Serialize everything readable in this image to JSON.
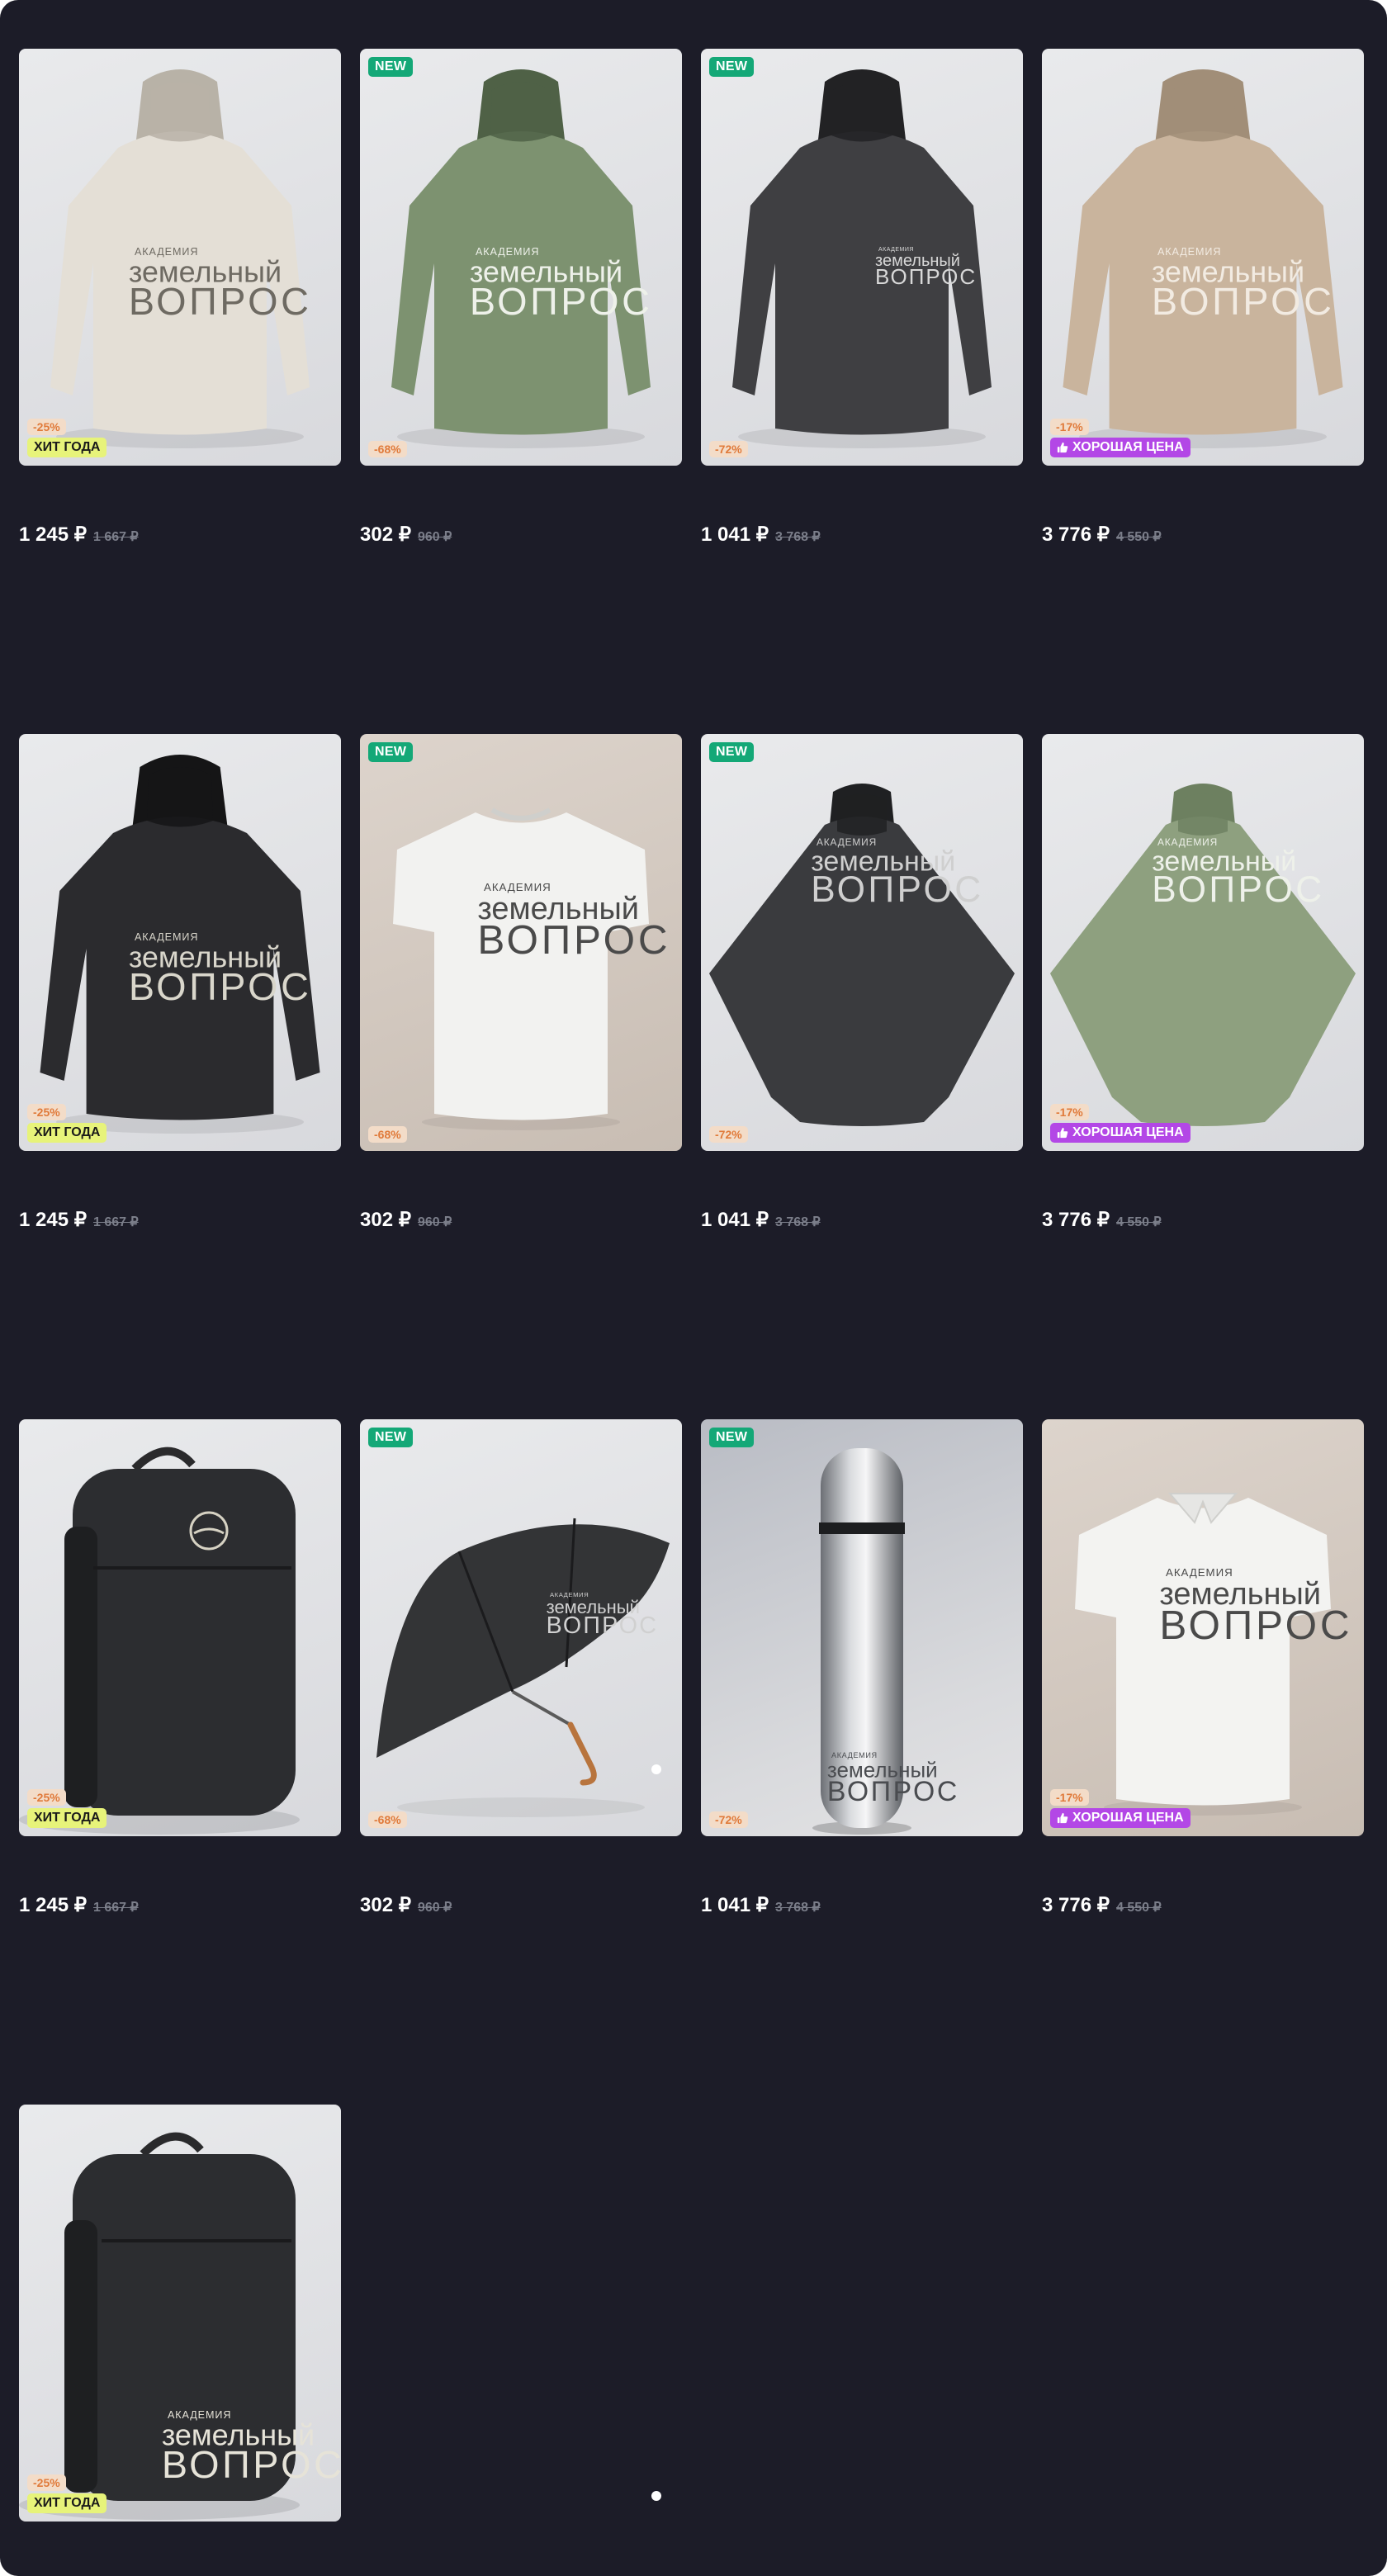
{
  "products": [
    {
      "image": "cream-hoodie",
      "new_badge": "",
      "discount": "-25%",
      "label": "ХИТ ГОДА",
      "label_type": "hit",
      "price": "1 245 ₽",
      "old_price": "1 667 ₽"
    },
    {
      "image": "green-hoodie",
      "new_badge": "NEW",
      "discount": "-68%",
      "label": "",
      "label_type": "",
      "price": "302 ₽",
      "old_price": "960 ₽"
    },
    {
      "image": "graphite-hoodie",
      "new_badge": "NEW",
      "discount": "-72%",
      "label": "",
      "label_type": "",
      "price": "1 041 ₽",
      "old_price": "3 768 ₽"
    },
    {
      "image": "beige-hoodie",
      "new_badge": "",
      "discount": "-17%",
      "label": "ХОРОШАЯ ЦЕНА",
      "label_type": "good-price",
      "price": "3 776 ₽",
      "old_price": "4 550 ₽"
    },
    {
      "image": "black-hoodie",
      "new_badge": "",
      "discount": "-25%",
      "label": "ХИТ ГОДА",
      "label_type": "hit",
      "price": "1 245 ₽",
      "old_price": "1 667 ₽"
    },
    {
      "image": "white-tshirt",
      "new_badge": "NEW",
      "discount": "-68%",
      "label": "",
      "label_type": "",
      "price": "302 ₽",
      "old_price": "960 ₽"
    },
    {
      "image": "black-poncho",
      "new_badge": "NEW",
      "discount": "-72%",
      "label": "",
      "label_type": "",
      "price": "1 041 ₽",
      "old_price": "3 768 ₽"
    },
    {
      "image": "green-poncho",
      "new_badge": "",
      "discount": "-17%",
      "label": "ХОРОШАЯ ЦЕНА",
      "label_type": "good-price",
      "price": "3 776 ₽",
      "old_price": "4 550 ₽"
    },
    {
      "image": "black-backpack-emblem",
      "new_badge": "",
      "discount": "-25%",
      "label": "ХИТ ГОДА",
      "label_type": "hit",
      "price": "1 245 ₽",
      "old_price": "1 667 ₽"
    },
    {
      "image": "black-umbrella",
      "new_badge": "NEW",
      "discount": "-68%",
      "label": "",
      "label_type": "",
      "price": "302 ₽",
      "old_price": "960 ₽"
    },
    {
      "image": "steel-thermos",
      "new_badge": "NEW",
      "discount": "-72%",
      "label": "",
      "label_type": "",
      "price": "1 041 ₽",
      "old_price": "3 768 ₽"
    },
    {
      "image": "white-polo",
      "new_badge": "",
      "discount": "-17%",
      "label": "ХОРОШАЯ ЦЕНА",
      "label_type": "good-price",
      "price": "3 776 ₽",
      "old_price": "4 550 ₽"
    },
    {
      "image": "black-backpack-logo",
      "new_badge": "",
      "discount": "-25%",
      "label": "ХИТ ГОДА",
      "label_type": "hit",
      "price": "1 245 ₽",
      "old_price": "1 667 ₽"
    }
  ],
  "logo": {
    "line1": "АКАДЕМИЯ",
    "line2": "земельный",
    "line3": "ВОПРОС"
  },
  "icons": {
    "good_price": "thumbs-up-icon",
    "pagination": "dot-indicator"
  },
  "colors": {
    "background": "#1c1c28",
    "new_badge": "#14a877",
    "hit_badge": "#e7f37a",
    "good_price_badge": "#b347e6",
    "discount_badge": "#f3dcc8",
    "old_price": "#7b7e8a"
  }
}
